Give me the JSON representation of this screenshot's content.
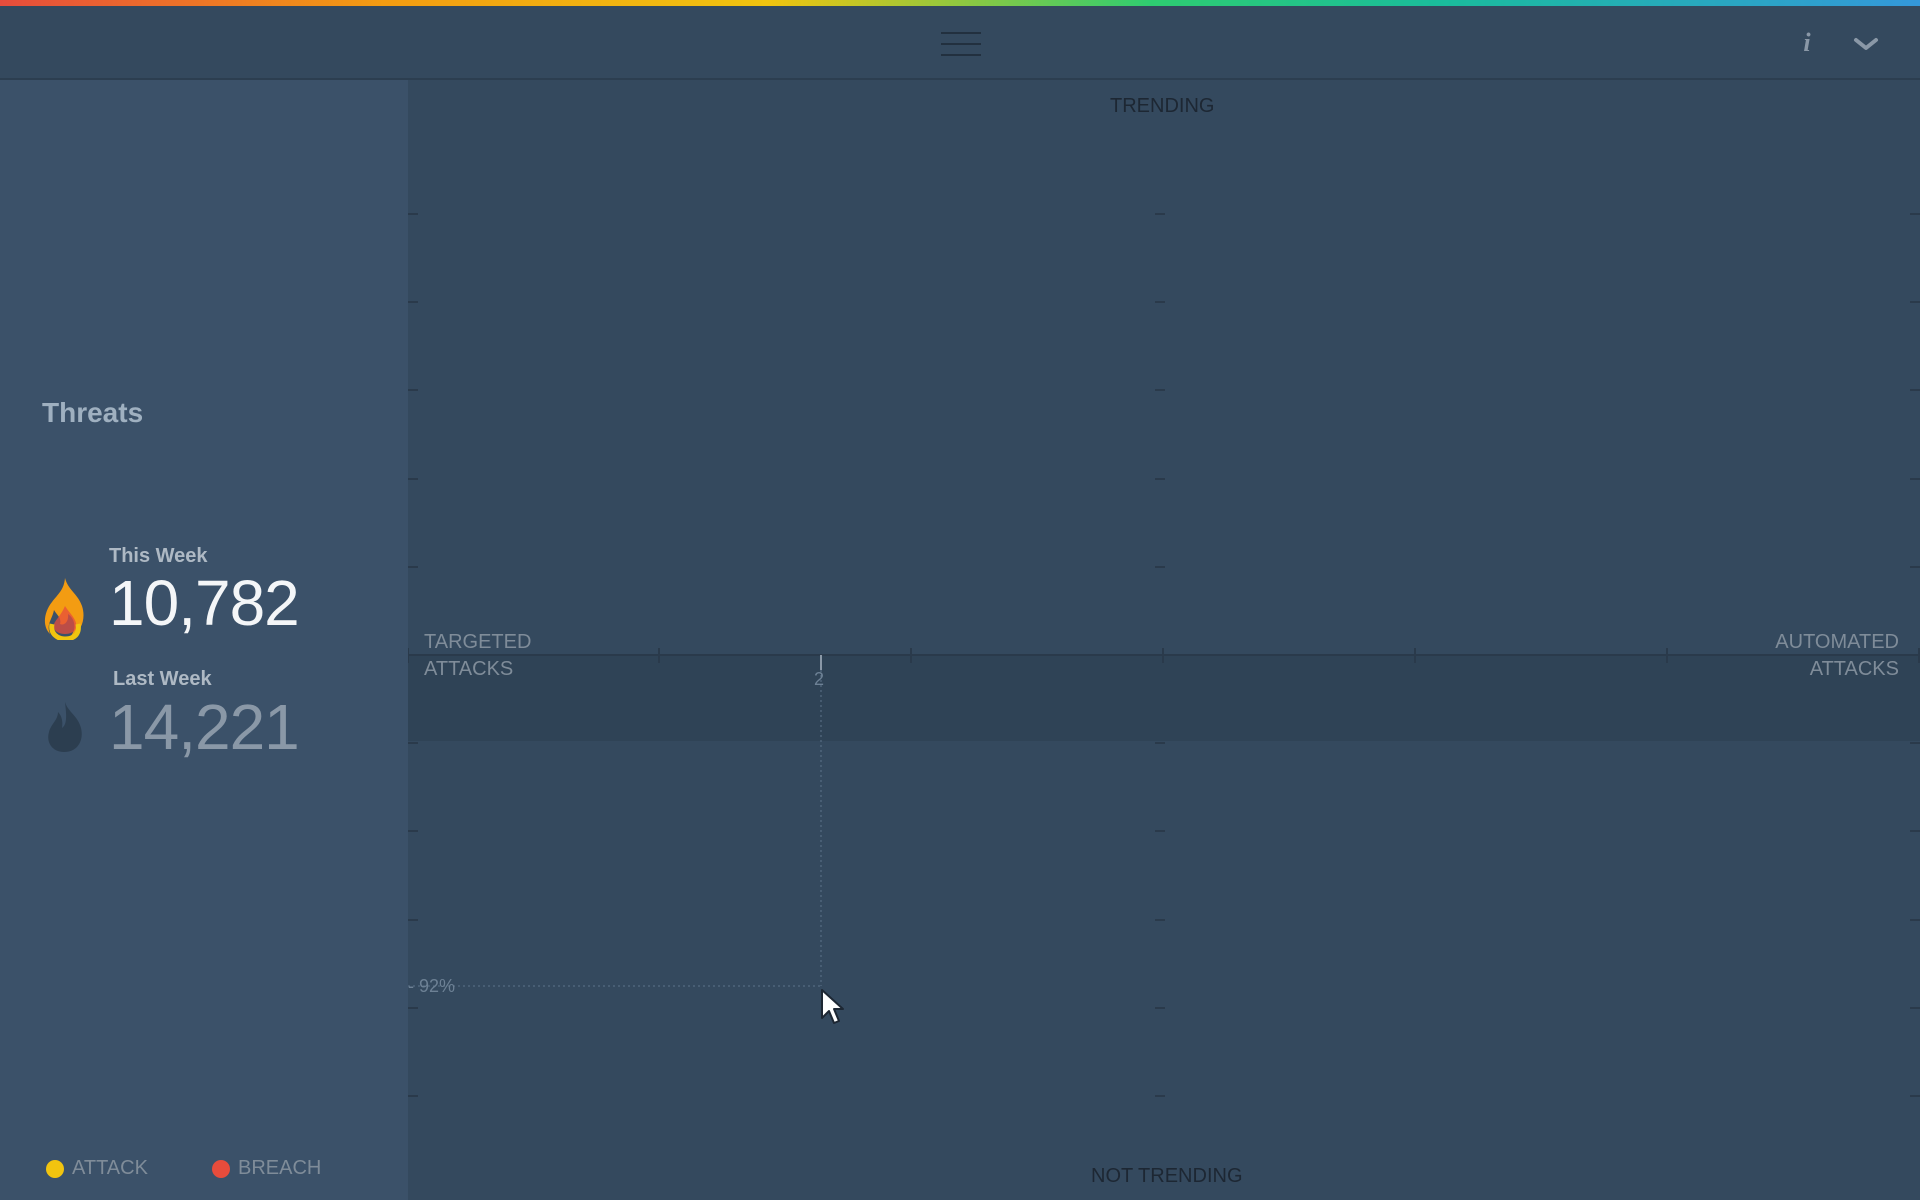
{
  "header": {
    "menu_icon": "hamburger-menu-icon",
    "info_icon": "i",
    "collapse_icon": "chevron-down-icon"
  },
  "sidebar": {
    "title": "Threats",
    "this_week": {
      "label": "This Week",
      "value": "10,782",
      "icon": "flame-icon"
    },
    "last_week": {
      "label": "Last Week",
      "value": "14,221",
      "icon": "flame-icon"
    }
  },
  "legend": [
    {
      "label": "ATTACK",
      "color": "#f1c40f"
    },
    {
      "label": "BREACH",
      "color": "#e74c3c"
    }
  ],
  "chart": {
    "top_label": "TRENDING",
    "bottom_label": "NOT TRENDING",
    "left_label_line1": "TARGETED",
    "left_label_line2": "ATTACKS",
    "right_label_line1": "AUTOMATED",
    "right_label_line2": "ATTACKS",
    "hover_x_label": "2",
    "hover_y_label": "- 92%"
  },
  "colors": {
    "background": "#34495e",
    "sidebar": "#3b5169",
    "flame_active": "#f39c12",
    "flame_inactive": "#2c3e50"
  }
}
